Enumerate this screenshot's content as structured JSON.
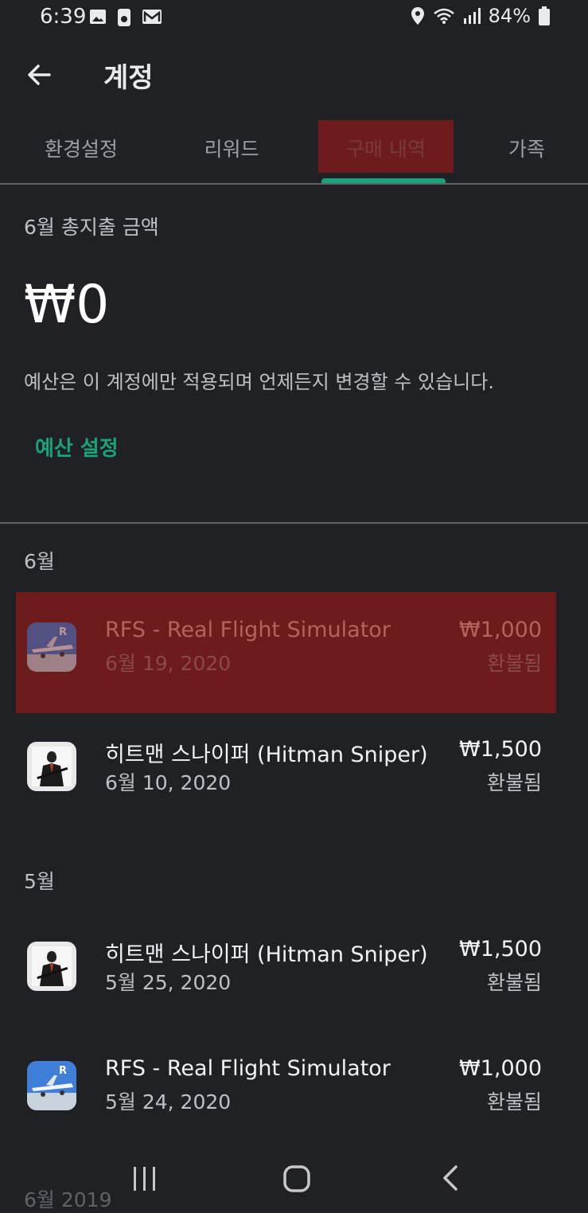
{
  "status_bar": {
    "time": "6:39",
    "battery": "84%"
  },
  "app_bar": {
    "title": "계정"
  },
  "tabs": [
    {
      "label": "환경설정"
    },
    {
      "label": "리워드"
    },
    {
      "label": "구매 내역"
    },
    {
      "label": "가족"
    }
  ],
  "budget": {
    "month_label": "6월 총지출 금액",
    "amount": "₩0",
    "note": "예산은 이 계정에만 적용되며 언제든지 변경할 수 있습니다.",
    "set_budget_label": "예산 설정"
  },
  "sections": [
    {
      "label": "6월",
      "items": [
        {
          "name": "RFS - Real Flight Simulator",
          "date": "6월 19, 2020",
          "price": "₩1,000",
          "status": "환불됨",
          "icon": "rfs-app-icon"
        },
        {
          "name": "히트맨 스나이퍼 (Hitman Sniper)",
          "date": "6월 10, 2020",
          "price": "₩1,500",
          "status": "환불됨",
          "icon": "hitman-app-icon"
        }
      ]
    },
    {
      "label": "5월",
      "items": [
        {
          "name": "히트맨 스나이퍼 (Hitman Sniper)",
          "date": "5월 25, 2020",
          "price": "₩1,500",
          "status": "환불됨",
          "icon": "hitman-app-icon"
        },
        {
          "name": "RFS - Real Flight Simulator",
          "date": "5월 24, 2020",
          "price": "₩1,000",
          "status": "환불됨",
          "icon": "rfs-app-icon"
        }
      ]
    }
  ],
  "next_section_label": "6월 2019",
  "colors": {
    "background": "#202124",
    "accent": "#19a27c",
    "highlight": "#6e1b1b"
  }
}
